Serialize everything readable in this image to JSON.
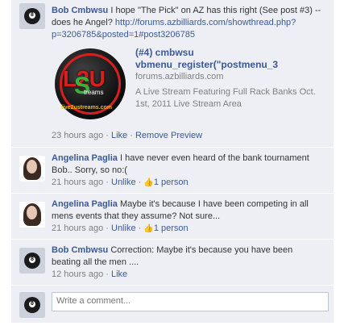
{
  "comments": [
    {
      "author": "Bob Cmbwsu",
      "text": " I hope \"The Pick\" on AZ has this right (See post #3) -- does he Angel? ",
      "link": "http://forums.azbilliards.com/showthread.php?p=3206785&posted=1#post3206785",
      "preview": {
        "title_line1": "(#4) cmbwsu",
        "title_line2": "vbmenu_register(\"postmenu_3",
        "domain": "forums.azbilliards.com",
        "desc": "A Live Stream Featuring Full Rack Banks Oct. 1st, 2011 Live Stream Area",
        "logo_big": "L2U",
        "logo_s": "S",
        "logo_streams": "treams",
        "logo_url": "live2ustreams.com"
      },
      "time": "23 hours ago",
      "actions": [
        "Like",
        "Remove Preview"
      ]
    },
    {
      "author": "Angelina Paglia",
      "text": " I have never even heard of the bank tournament Bob.. Sorry, so no:(",
      "time": "21 hours ago",
      "actions": [
        "Unlike",
        "1 person"
      ]
    },
    {
      "author": "Angelina Paglia",
      "text": " Maybe it's because I have been competing in all mens events that they assume? Not sure...",
      "time": "21 hours ago",
      "actions": [
        "Unlike",
        "1 person"
      ]
    },
    {
      "author": "Bob Cmbwsu",
      "text": " Correction: Maybe it's because you have been beating all the men ....",
      "time": "12 hours ago",
      "actions": [
        "Like"
      ]
    }
  ],
  "composer": {
    "placeholder": "Write a comment..."
  },
  "ui": {
    "separator": " · ",
    "ball_number": "8"
  },
  "icons": {
    "like": "thumbs-up-icon"
  }
}
